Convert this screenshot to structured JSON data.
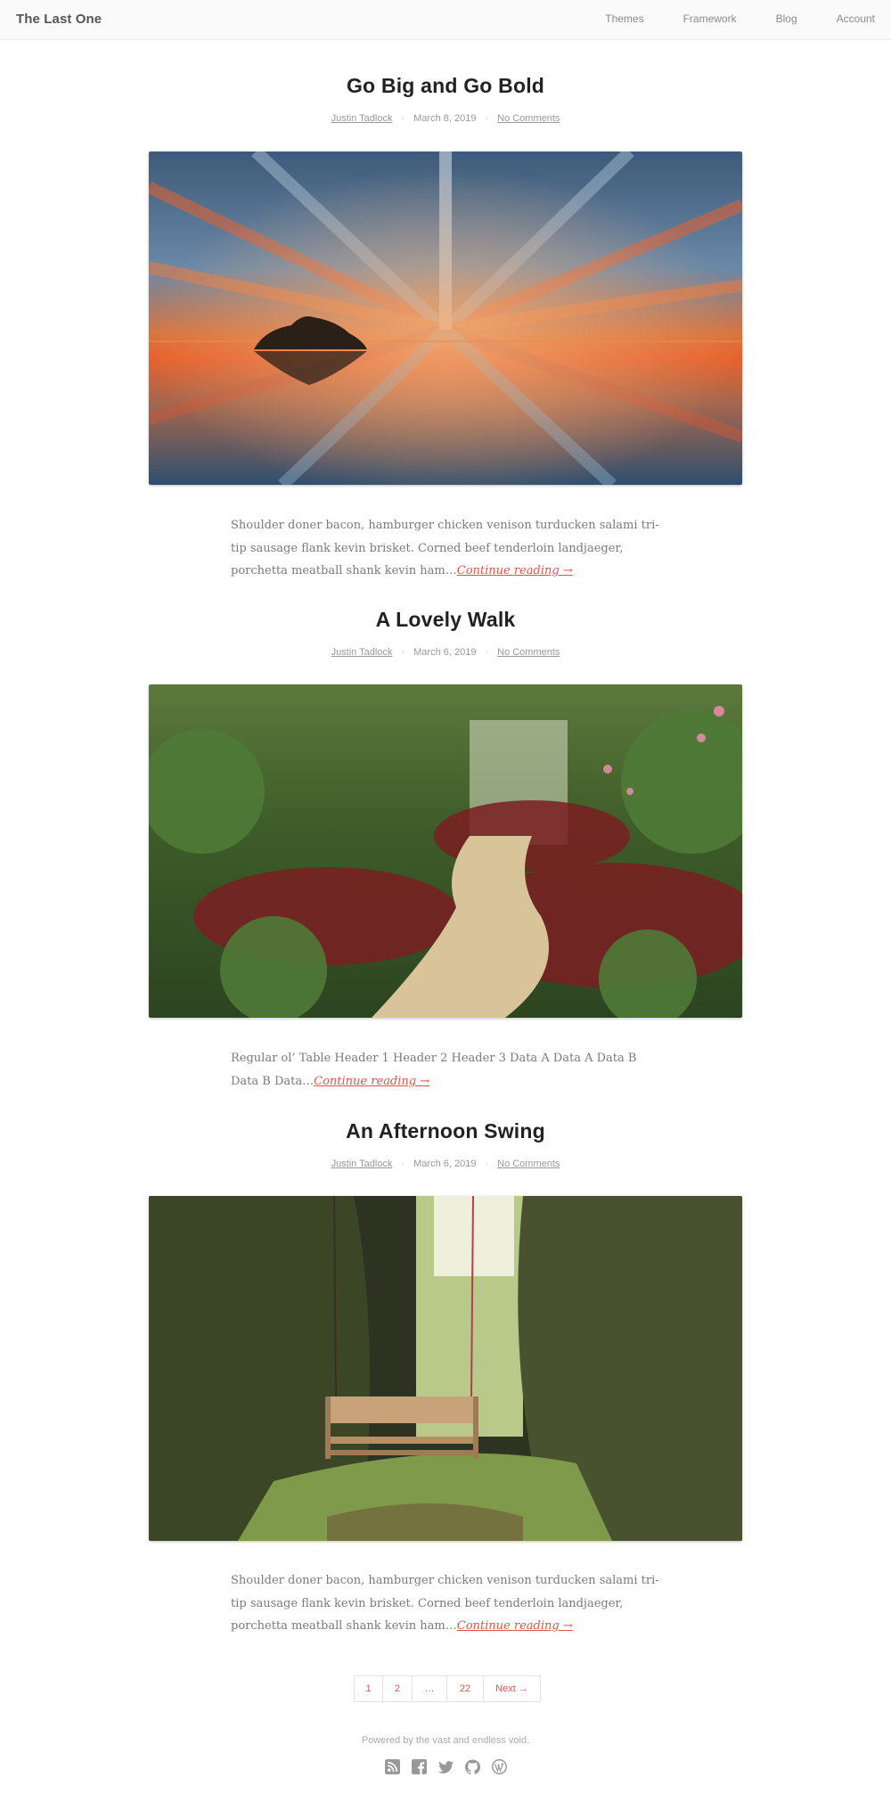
{
  "header": {
    "site_title": "The Last One",
    "nav": [
      "Themes",
      "Framework",
      "Blog",
      "Account"
    ]
  },
  "posts": [
    {
      "title": "Go Big and Go Bold",
      "author": "Justin Tadlock",
      "date": "March 8, 2019",
      "comments": "No Comments",
      "image_alt": "Island at sunset with streaked clouds reflected on water",
      "excerpt": "Shoulder doner bacon, hamburger chicken venison turducken salami tri-tip sausage flank kevin brisket. Corned beef tenderloin landjaeger, porchetta meatball shank kevin ham…",
      "read_more": "Continue reading →"
    },
    {
      "title": "A Lovely Walk",
      "author": "Justin Tadlock",
      "date": "March 6, 2019",
      "comments": "No Comments",
      "image_alt": "Stone path winding through a lush garden",
      "excerpt": "Regular ol’ Table Header 1 Header 2 Header 3 Data A Data A Data B Data B Data…",
      "read_more": "Continue reading →"
    },
    {
      "title": "An Afternoon Swing",
      "author": "Justin Tadlock",
      "date": "March 6, 2019",
      "comments": "No Comments",
      "image_alt": "Wooden swing bench hanging between leafy hedges",
      "excerpt": "Shoulder doner bacon, hamburger chicken venison turducken salami tri-tip sausage flank kevin brisket. Corned beef tenderloin landjaeger, porchetta meatball shank kevin ham…",
      "read_more": "Continue reading →"
    }
  ],
  "meta_separator": "·",
  "pagination": {
    "pages": [
      "1",
      "2",
      "…",
      "22"
    ],
    "next": "Next →"
  },
  "footer": {
    "text": "Powered by the vast and endless void.",
    "social_icons": [
      "rss-icon",
      "facebook-icon",
      "twitter-icon",
      "github-icon",
      "wordpress-icon"
    ]
  },
  "colors": {
    "accent": "#e05545",
    "title": "#222222",
    "meta": "#999999"
  }
}
